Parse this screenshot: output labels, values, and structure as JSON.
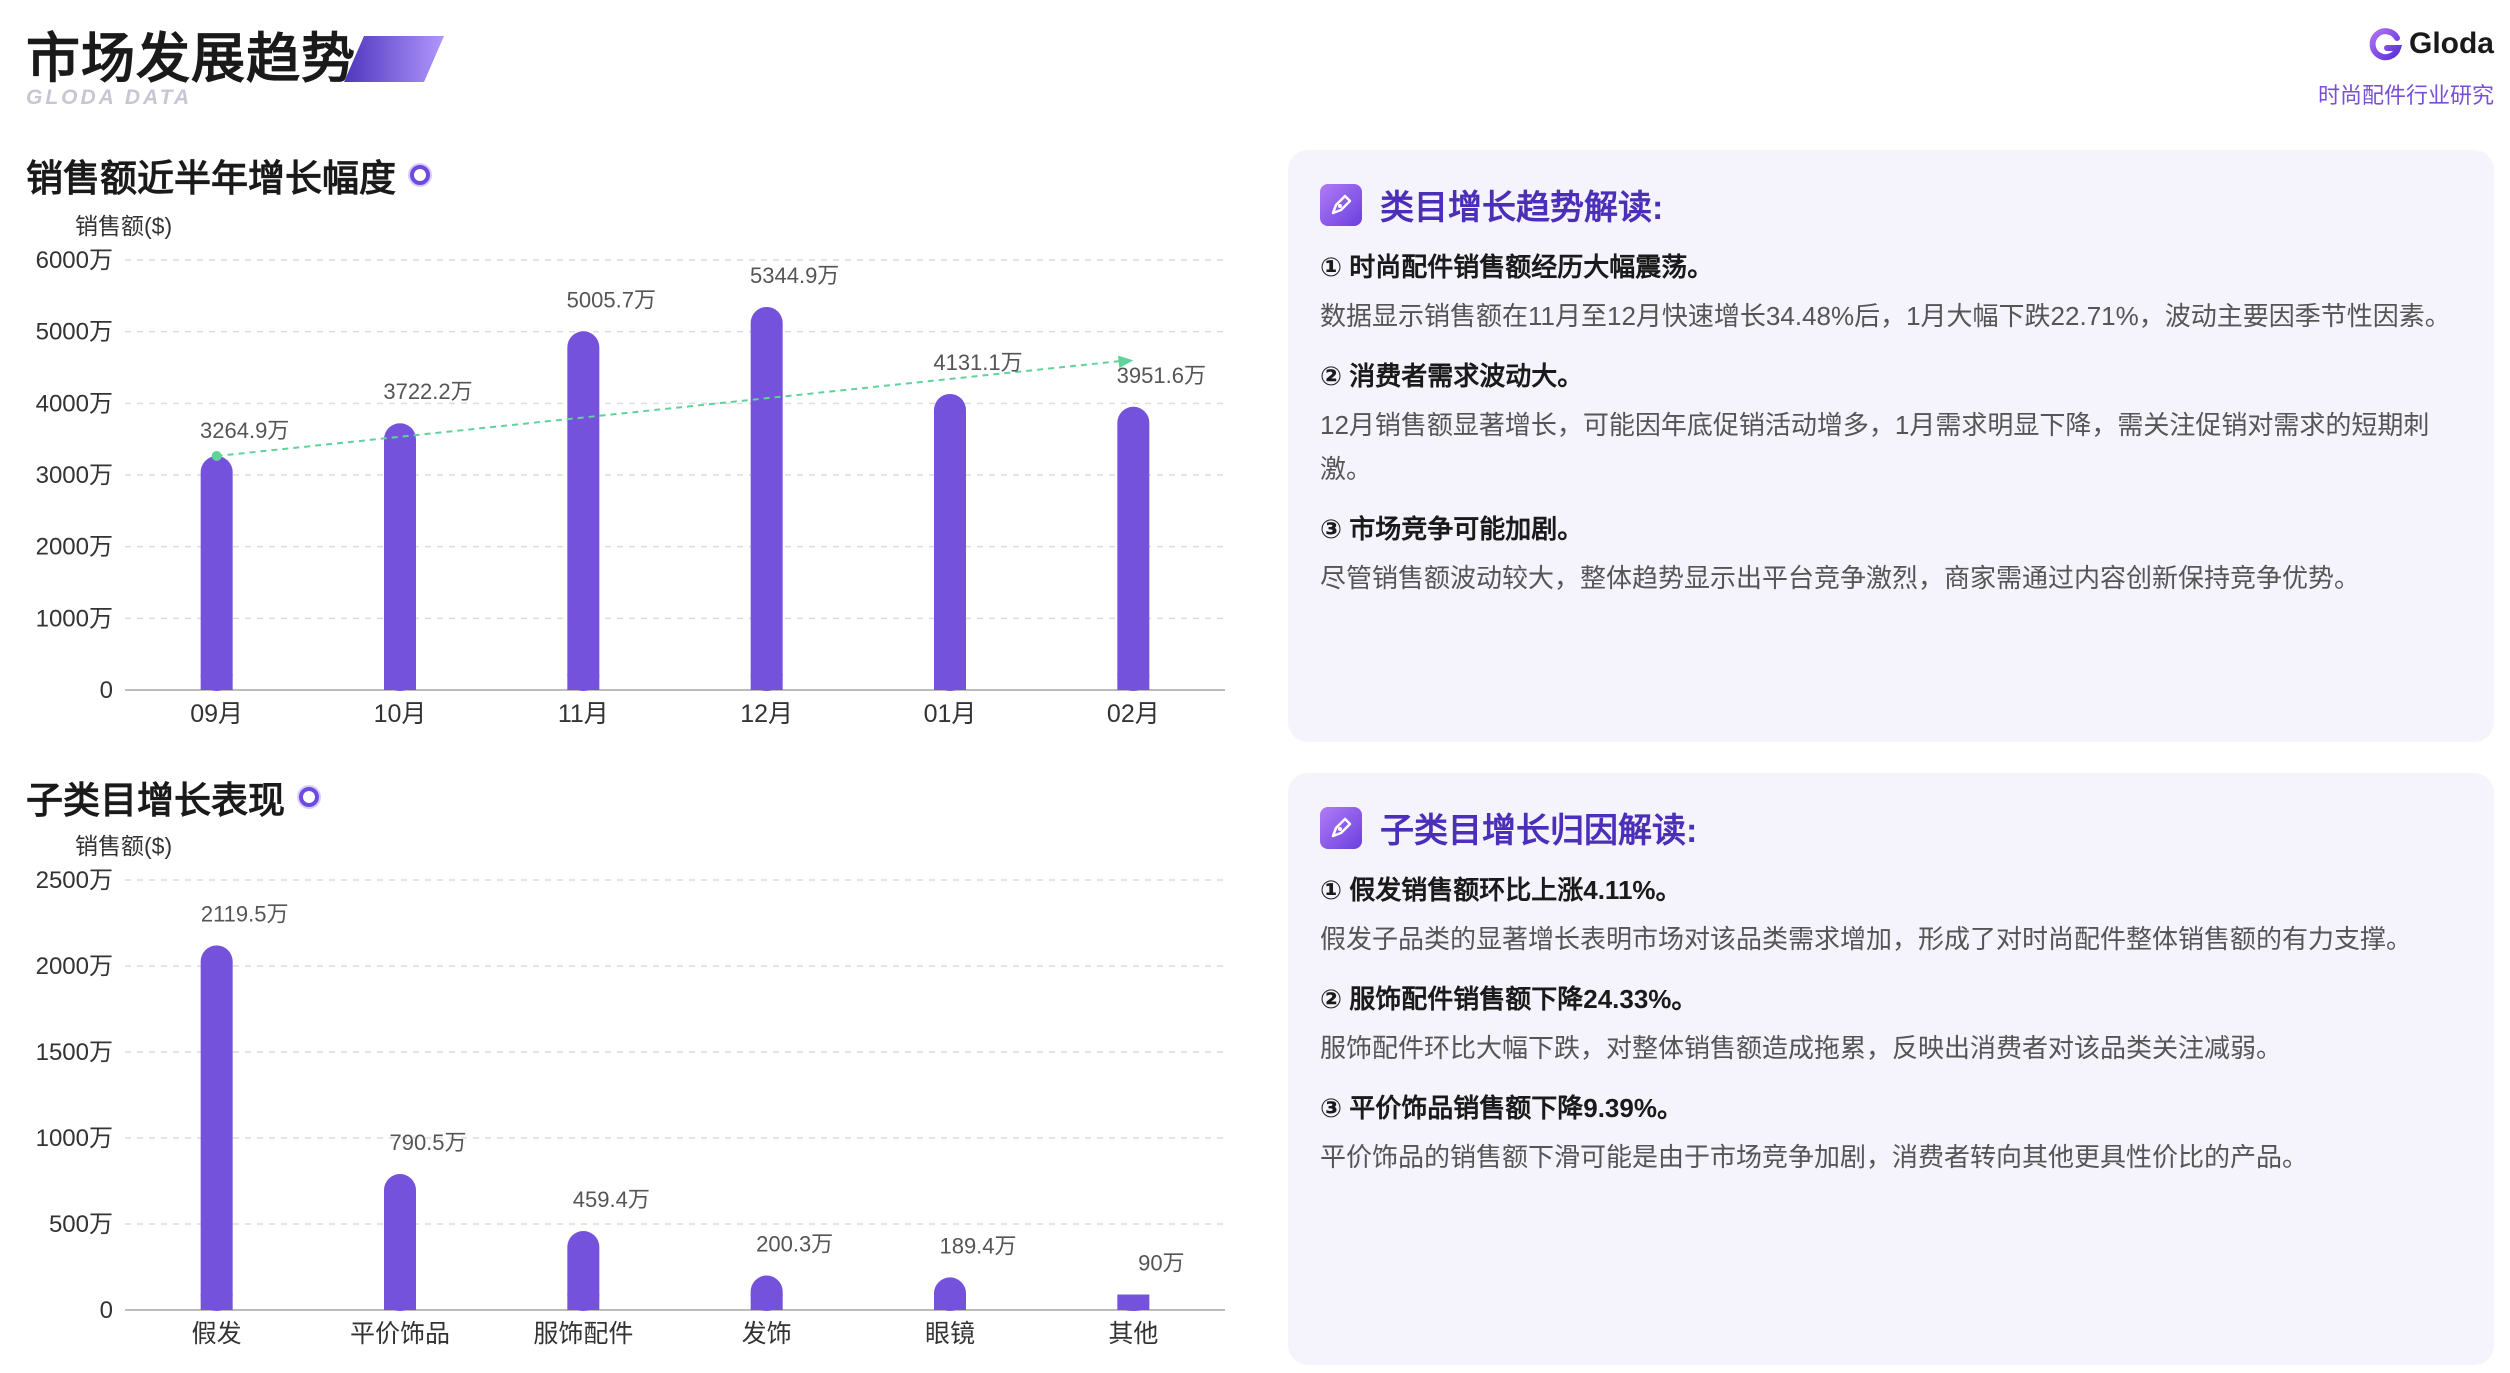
{
  "header": {
    "title": "市场发展趋势",
    "subtitle": "GLODA DATA",
    "brand_name": "Gloda",
    "brand_tag": "时尚配件行业研究"
  },
  "sections": {
    "sales_title": "销售额近半年增长幅度",
    "sub_title": "子类目增长表现"
  },
  "colors": {
    "bar": "#7552dc",
    "trend": "#5fd39a",
    "accent": "#4b2fb8"
  },
  "chart_data": [
    {
      "type": "bar",
      "ylabel": "销售额($)",
      "categories": [
        "09月",
        "10月",
        "11月",
        "12月",
        "01月",
        "02月"
      ],
      "values": [
        3264.9,
        3722.2,
        5005.7,
        5344.9,
        4131.1,
        3951.6
      ],
      "data_labels": [
        "3264.9万",
        "3722.2万",
        "5005.7万",
        "5344.9万",
        "4131.1万",
        "3951.6万"
      ],
      "yticks": [
        "0",
        "1000万",
        "2000万",
        "3000万",
        "4000万",
        "5000万",
        "6000万"
      ],
      "ylim": [
        0,
        6000
      ],
      "trendline": {
        "from": 3264.9,
        "to": 4600
      },
      "grid": true
    },
    {
      "type": "bar",
      "ylabel": "销售额($)",
      "categories": [
        "假发",
        "平价饰品",
        "服饰配件",
        "发饰",
        "眼镜",
        "其他"
      ],
      "values": [
        2119.5,
        790.5,
        459.4,
        200.3,
        189.4,
        90
      ],
      "data_labels": [
        "2119.5万",
        "790.5万",
        "459.4万",
        "200.3万",
        "189.4万",
        "90万"
      ],
      "yticks": [
        "0",
        "500万",
        "1000万",
        "1500万",
        "2000万",
        "2500万"
      ],
      "ylim": [
        0,
        2500
      ],
      "grid": true
    }
  ],
  "panels": [
    {
      "title": "类目增长趋势解读:",
      "points": [
        {
          "head": "① 时尚配件销售额经历大幅震荡。",
          "body": "数据显示销售额在11月至12月快速增长34.48%后，1月大幅下跌22.71%，波动主要因季节性因素。"
        },
        {
          "head": "② 消费者需求波动大。",
          "body": "12月销售额显著增长，可能因年底促销活动增多，1月需求明显下降，需关注促销对需求的短期刺激。"
        },
        {
          "head": "③ 市场竞争可能加剧。",
          "body": "尽管销售额波动较大，整体趋势显示出平台竞争激烈，商家需通过内容创新保持竞争优势。"
        }
      ]
    },
    {
      "title": "子类目增长归因解读:",
      "points": [
        {
          "head": "① 假发销售额环比上涨4.11%。",
          "body": "假发子品类的显著增长表明市场对该品类需求增加，形成了对时尚配件整体销售额的有力支撑。"
        },
        {
          "head": "② 服饰配件销售额下降24.33%。",
          "body": "服饰配件环比大幅下跌，对整体销售额造成拖累，反映出消费者对该品类关注减弱。"
        },
        {
          "head": "③ 平价饰品销售额下降9.39%。",
          "body": "平价饰品的销售额下滑可能是由于市场竞争加剧，消费者转向其他更具性价比的产品。"
        }
      ]
    }
  ]
}
